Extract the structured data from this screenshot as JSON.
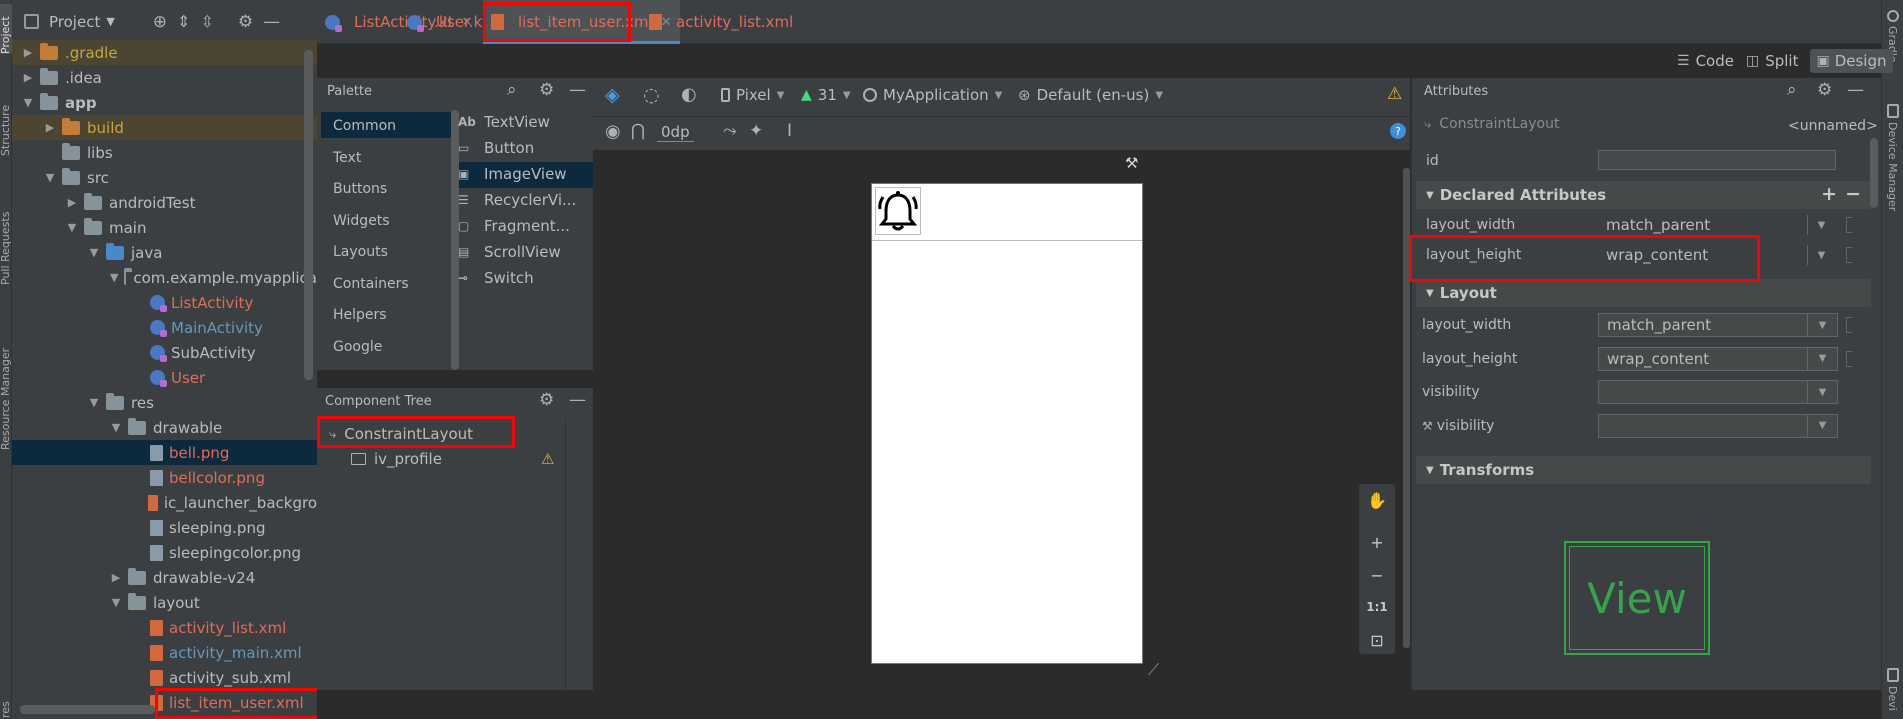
{
  "strips": {
    "left": [
      "Project",
      "Structure",
      "Pull Requests",
      "Resource Manager",
      "res"
    ],
    "right": [
      "Gradle",
      "Device Manager",
      "Devi"
    ]
  },
  "project": {
    "title": "Project",
    "tree": [
      {
        "label": "gradle",
        "prefix": ".",
        "indent": 0,
        "arrow": "▶",
        "icon": "folder-orange",
        "color": "#c3a93b"
      },
      {
        "label": ".idea",
        "indent": 0,
        "arrow": "▶",
        "icon": "folder",
        "color": "#bbbbbb"
      },
      {
        "label": "app",
        "indent": 0,
        "arrow": "▼",
        "icon": "folder",
        "color": "#bbbbbb",
        "bold": true
      },
      {
        "label": "build",
        "indent": 1,
        "arrow": "▶",
        "icon": "folder-orange",
        "color": "#c3a93b"
      },
      {
        "label": "libs",
        "indent": 1,
        "arrow": "",
        "icon": "folder",
        "color": "#bbbbbb"
      },
      {
        "label": "src",
        "indent": 1,
        "arrow": "▼",
        "icon": "folder",
        "color": "#bbbbbb"
      },
      {
        "label": "androidTest",
        "indent": 2,
        "arrow": "▶",
        "icon": "folder",
        "color": "#bbbbbb"
      },
      {
        "label": "main",
        "indent": 2,
        "arrow": "▼",
        "icon": "folder",
        "color": "#bbbbbb"
      },
      {
        "label": "java",
        "indent": 3,
        "arrow": "▼",
        "icon": "folder-blue",
        "color": "#bbbbbb"
      },
      {
        "label": "com.example.myapplica",
        "indent": 4,
        "arrow": "▼",
        "icon": "folder",
        "color": "#bbbbbb"
      },
      {
        "label": "ListActivity",
        "indent": 5,
        "arrow": "",
        "icon": "kt",
        "color": "#e06c5a"
      },
      {
        "label": "MainActivity",
        "indent": 5,
        "arrow": "",
        "icon": "kt",
        "color": "#6897bb"
      },
      {
        "label": "SubActivity",
        "indent": 5,
        "arrow": "",
        "icon": "kt",
        "color": "#bbbbbb"
      },
      {
        "label": "User",
        "indent": 5,
        "arrow": "",
        "icon": "kt",
        "color": "#e06c5a"
      },
      {
        "label": "res",
        "indent": 3,
        "arrow": "▼",
        "icon": "folder",
        "color": "#bbbbbb"
      },
      {
        "label": "drawable",
        "indent": 4,
        "arrow": "▼",
        "icon": "folder",
        "color": "#bbbbbb"
      },
      {
        "label": "bell.png",
        "indent": 5,
        "arrow": "",
        "icon": "img",
        "color": "#e06c5a",
        "selected": true
      },
      {
        "label": "bellcolor.png",
        "indent": 5,
        "arrow": "",
        "icon": "img",
        "color": "#e06c5a"
      },
      {
        "label": "ic_launcher_backgro",
        "indent": 5,
        "arrow": "",
        "icon": "xml",
        "color": "#bbbbbb"
      },
      {
        "label": "sleeping.png",
        "indent": 5,
        "arrow": "",
        "icon": "img",
        "color": "#bbbbbb"
      },
      {
        "label": "sleepingcolor.png",
        "indent": 5,
        "arrow": "",
        "icon": "img",
        "color": "#bbbbbb"
      },
      {
        "label": "drawable-v24",
        "indent": 4,
        "arrow": "▶",
        "icon": "folder",
        "color": "#bbbbbb"
      },
      {
        "label": "layout",
        "indent": 4,
        "arrow": "▼",
        "icon": "folder",
        "color": "#bbbbbb"
      },
      {
        "label": "activity_list.xml",
        "indent": 5,
        "arrow": "",
        "icon": "xml",
        "color": "#e06c5a"
      },
      {
        "label": "activity_main.xml",
        "indent": 5,
        "arrow": "",
        "icon": "xml",
        "color": "#6897bb"
      },
      {
        "label": "activity_sub.xml",
        "indent": 5,
        "arrow": "",
        "icon": "xml",
        "color": "#bbbbbb"
      },
      {
        "label": "list_item_user.xml",
        "indent": 5,
        "arrow": "",
        "icon": "xml",
        "color": "#e06c5a"
      }
    ]
  },
  "tabs": [
    {
      "label": "ListActivity.kt",
      "icon": "kt",
      "color": "#e06c5a"
    },
    {
      "label": "User.kt",
      "icon": "kt",
      "color": "#e06c5a"
    },
    {
      "label": "list_item_user.xml",
      "icon": "xml",
      "color": "#e06c5a",
      "active": true
    },
    {
      "label": "activity_list.xml",
      "icon": "xml",
      "color": "#e06c5a"
    }
  ],
  "view_modes": {
    "code": "Code",
    "split": "Split",
    "design": "Design"
  },
  "palette": {
    "title": "Palette",
    "categories": [
      "Common",
      "Text",
      "Buttons",
      "Widgets",
      "Layouts",
      "Containers",
      "Helpers",
      "Google"
    ],
    "items": [
      {
        "label": "TextView",
        "icon": "Ab"
      },
      {
        "label": "Button",
        "icon": "btn"
      },
      {
        "label": "ImageView",
        "icon": "img"
      },
      {
        "label": "RecyclerVi...",
        "icon": "list"
      },
      {
        "label": "Fragment...",
        "icon": "frag"
      },
      {
        "label": "ScrollView",
        "icon": "scroll"
      },
      {
        "label": "Switch",
        "icon": "switch"
      }
    ]
  },
  "toolbar": {
    "device": "Pixel",
    "api": "31",
    "app": "MyApplication",
    "locale": "Default (en-us)",
    "margin": "0dp"
  },
  "component_tree": {
    "title": "Component Tree",
    "root": "ConstraintLayout",
    "child": "iv_profile"
  },
  "attributes": {
    "title": "Attributes",
    "component": "ConstraintLayout",
    "name": "<unnamed>",
    "id_label": "id",
    "id_value": "",
    "declared_title": "Declared Attributes",
    "declared": [
      {
        "name": "layout_width",
        "value": "match_parent"
      },
      {
        "name": "layout_height",
        "value": "wrap_content"
      }
    ],
    "layout_title": "Layout",
    "layout": [
      {
        "name": "layout_width",
        "value": "match_parent"
      },
      {
        "name": "layout_height",
        "value": "wrap_content"
      },
      {
        "name": "visibility",
        "value": ""
      },
      {
        "name": "visibility",
        "value": ""
      }
    ],
    "transforms_title": "Transforms",
    "preview_label": "View"
  },
  "zoom": {
    "plus": "+",
    "minus": "−",
    "one": "1:1"
  }
}
